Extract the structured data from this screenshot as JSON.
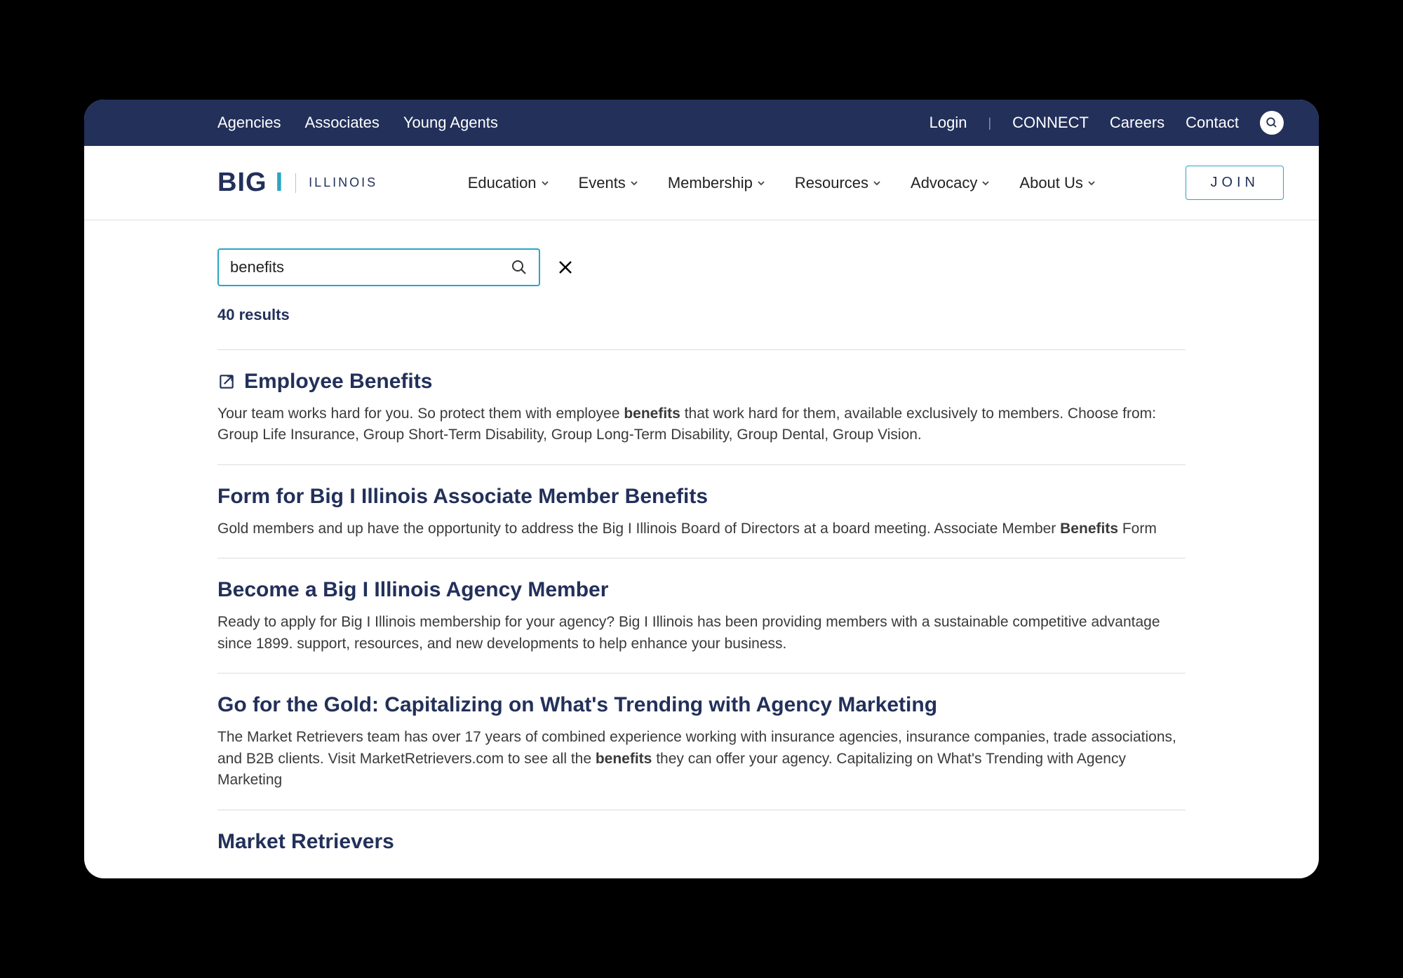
{
  "topBar": {
    "left": [
      "Agencies",
      "Associates",
      "Young Agents"
    ],
    "right": [
      "Login",
      "CONNECT",
      "Careers",
      "Contact"
    ]
  },
  "logo": {
    "big": "BIG",
    "i": "I",
    "illinois": "ILLINOIS"
  },
  "mainNav": [
    "Education",
    "Events",
    "Membership",
    "Resources",
    "Advocacy",
    "About Us"
  ],
  "joinLabel": "JOIN",
  "search": {
    "value": "benefits",
    "resultsCount": "40 results"
  },
  "results": [
    {
      "external": true,
      "title": "Employee Benefits",
      "descParts": [
        {
          "t": "Your team works hard for you. So protect them with employee "
        },
        {
          "t": "benefits",
          "b": true
        },
        {
          "t": " that work hard for them, available exclusively to members. Choose from: Group Life Insurance, Group Short-Term Disability, Group Long-Term Disability, Group Dental, Group Vision."
        }
      ]
    },
    {
      "external": false,
      "title": "Form for Big I Illinois Associate Member Benefits",
      "descParts": [
        {
          "t": "Gold members and up have the opportunity to address the Big I Illinois Board of Directors at a board meeting. Associate Member "
        },
        {
          "t": "Benefits",
          "b": true
        },
        {
          "t": " Form"
        }
      ]
    },
    {
      "external": false,
      "title": "Become a Big I Illinois Agency Member",
      "descParts": [
        {
          "t": "Ready to apply for Big I Illinois membership for your agency? Big I Illinois has been providing members with a sustainable competitive advantage since 1899. support, resources, and new developments to help enhance your business."
        }
      ]
    },
    {
      "external": false,
      "title": "Go for the Gold: Capitalizing on What's Trending with Agency Marketing",
      "descParts": [
        {
          "t": "The Market Retrievers team has over 17 years of combined experience working with insurance agencies, insurance companies, trade associations, and B2B clients. Visit MarketRetrievers.com to see all the "
        },
        {
          "t": "benefits",
          "b": true
        },
        {
          "t": " they can offer your agency. Capitalizing on What's Trending with Agency Marketing"
        }
      ]
    },
    {
      "external": false,
      "title": "Market Retrievers",
      "descParts": []
    }
  ]
}
